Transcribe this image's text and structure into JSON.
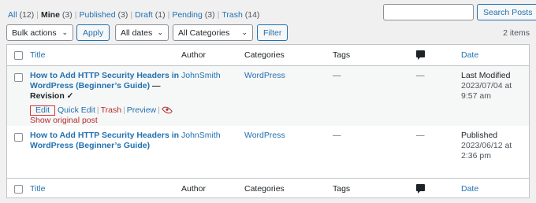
{
  "filters": {
    "all_label": "All",
    "all_count": "(12)",
    "mine_label": "Mine",
    "mine_count": "(3)",
    "published_label": "Published",
    "published_count": "(3)",
    "draft_label": "Draft",
    "draft_count": "(1)",
    "pending_label": "Pending",
    "pending_count": "(3)",
    "trash_label": "Trash",
    "trash_count": "(14)",
    "separator": "|"
  },
  "search": {
    "placeholder": "",
    "value": "",
    "button_label": "Search Posts"
  },
  "toolbar": {
    "bulk_actions": "Bulk actions",
    "apply_label": "Apply",
    "dates": "All dates",
    "categories": "All Categories",
    "filter_label": "Filter",
    "items_count": "2 items"
  },
  "table": {
    "columns": {
      "title": "Title",
      "author": "Author",
      "categories": "Categories",
      "tags": "Tags",
      "date": "Date"
    },
    "rows": [
      {
        "title": "How to Add HTTP Security Headers in WordPress (Beginner’s Guide)",
        "state": "— Revision ✓",
        "author": "JohnSmith",
        "categories": "WordPress",
        "tags": "—",
        "comments": "—",
        "date_status": "Last Modified",
        "date_value": "2023/07/04 at 9:57 am",
        "actions": {
          "edit": "Edit",
          "quick_edit": "Quick Edit",
          "trash": "Trash",
          "preview": "Preview",
          "show_original": "Show original post",
          "separator": "|"
        }
      },
      {
        "title": "How to Add HTTP Security Headers in WordPress (Beginner’s Guide)",
        "author": "JohnSmith",
        "categories": "WordPress",
        "tags": "—",
        "comments": "—",
        "date_status": "Published",
        "date_value": "2023/06/12 at 2:36 pm"
      }
    ]
  },
  "icons": {
    "comments": "comment-bubble-icon",
    "show_original": "eye-icon",
    "dropdown": "chevron-down-icon"
  },
  "colors": {
    "link": "#2271b1",
    "danger": "#b32d2e",
    "highlight_border": "#d63638"
  }
}
